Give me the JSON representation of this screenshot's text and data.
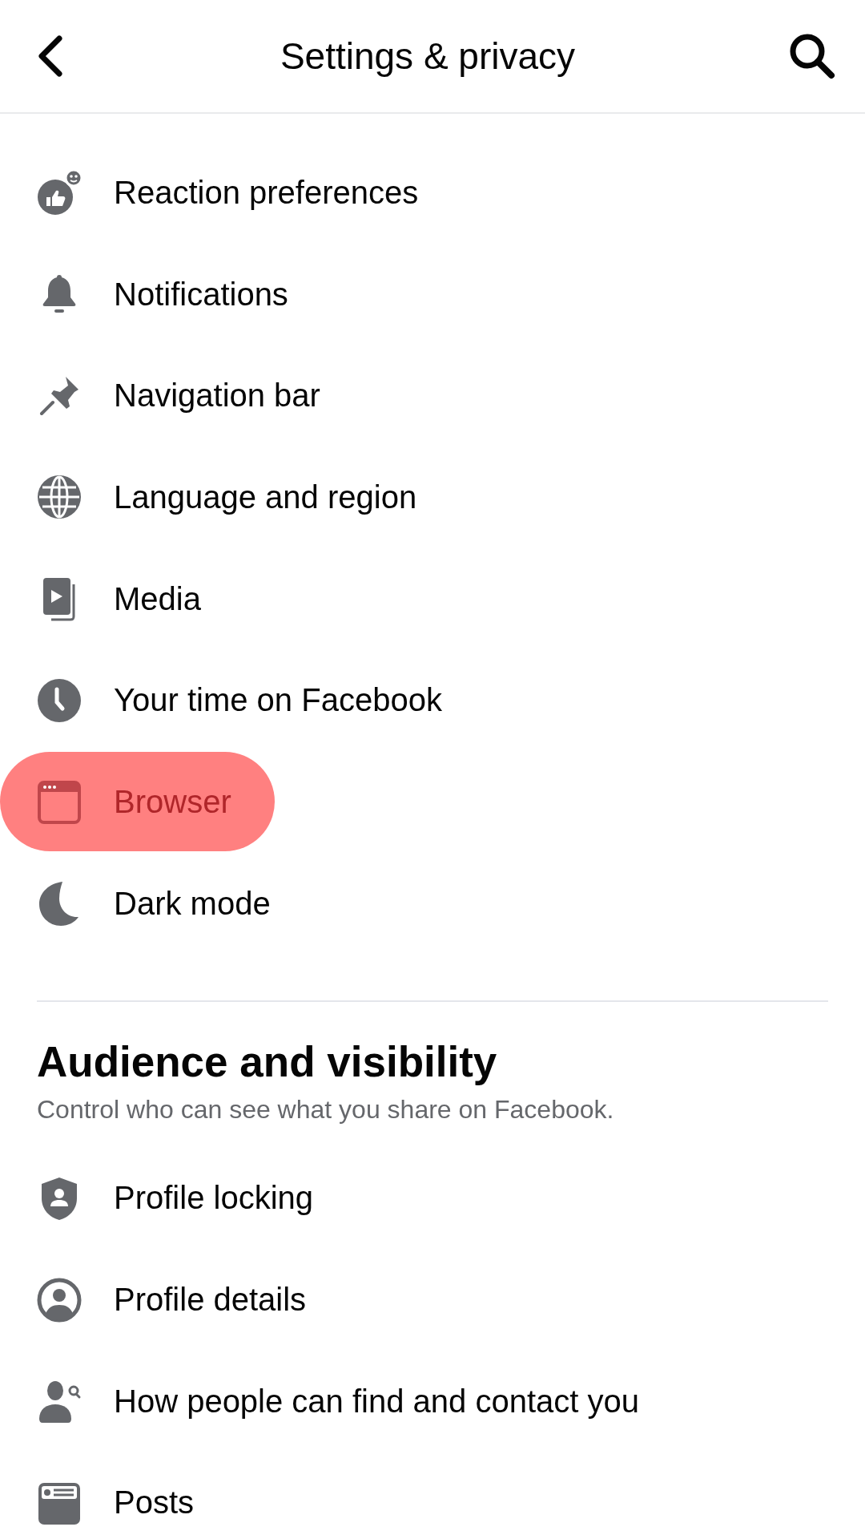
{
  "header": {
    "title": "Settings & privacy"
  },
  "preferences": {
    "items": [
      {
        "label": "Reaction preferences",
        "highlighted": false
      },
      {
        "label": "Notifications",
        "highlighted": false
      },
      {
        "label": "Navigation bar",
        "highlighted": false
      },
      {
        "label": "Language and region",
        "highlighted": false
      },
      {
        "label": "Media",
        "highlighted": false
      },
      {
        "label": "Your time on Facebook",
        "highlighted": false
      },
      {
        "label": "Browser",
        "highlighted": true
      },
      {
        "label": "Dark mode",
        "highlighted": false
      }
    ]
  },
  "audience": {
    "title": "Audience and visibility",
    "subtitle": "Control who can see what you share on Facebook.",
    "items": [
      {
        "label": "Profile locking",
        "highlighted": false
      },
      {
        "label": "Profile details",
        "highlighted": false
      },
      {
        "label": "How people can find and contact you",
        "highlighted": false
      },
      {
        "label": "Posts",
        "highlighted": false
      }
    ]
  }
}
